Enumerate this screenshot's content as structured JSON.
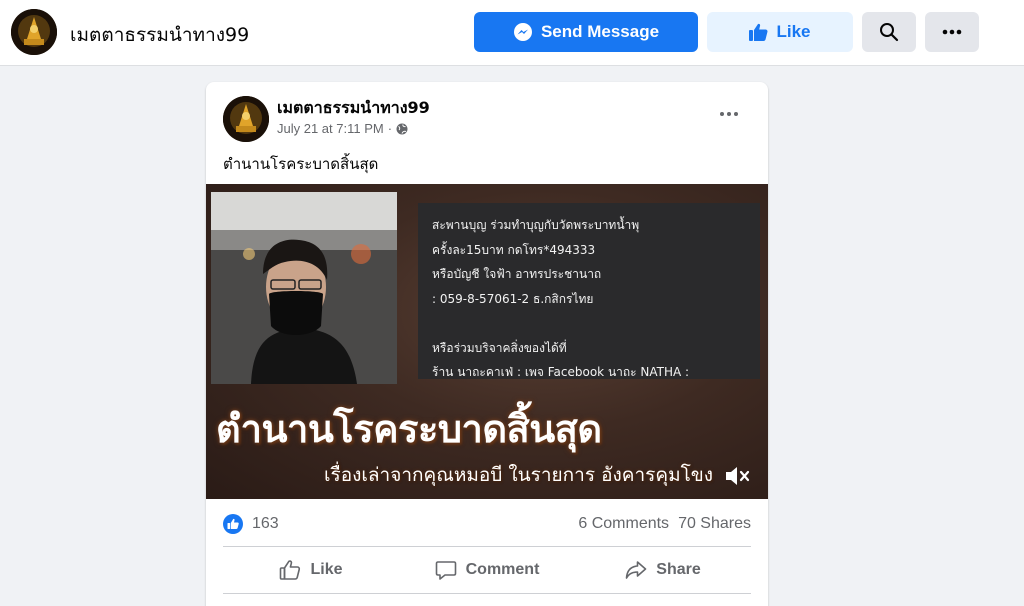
{
  "header": {
    "page_name": "เมตตาธรรมนำทาง99",
    "send_message_label": "Send Message",
    "like_label": "Like"
  },
  "post": {
    "author": "เมตตาธรรมนำทาง99",
    "timestamp": "July 21 at 7:11 PM",
    "separator": "·",
    "text": "ตำนานโรคระบาดสิ้นสุด",
    "video": {
      "info_lines": [
        "สะพานบุญ ร่วมทำบุญกับวัดพระบาทน้ำพุ",
        "ครั้งละ15บาท กดโทร*494333",
        "หรือบัญชี ใจฟ้า อาทรประชานาถ",
        ": 059-8-57061-2 ธ.กสิกรไทย",
        "",
        "หรือร่วมบริจาคสิ่งของได้ที่",
        "ร้าน นาถะคาเฟ่ : เพจ Facebook นาถะ NATHA :"
      ],
      "title_overlay": "ตำนานโรคระบาดสิ้นสุด",
      "subtitle_overlay": "เรื่องเล่าจากคุณหมอบี ในรายการ อังคารคุมโขง"
    },
    "reaction_count": "163",
    "comments": "6 Comments",
    "shares": "70 Shares",
    "actions": {
      "like": "Like",
      "comment": "Comment",
      "share": "Share"
    }
  },
  "colors": {
    "brand_blue": "#1877f2",
    "like_button_bg": "#e7f3ff",
    "page_bg": "#f0f2f5"
  }
}
